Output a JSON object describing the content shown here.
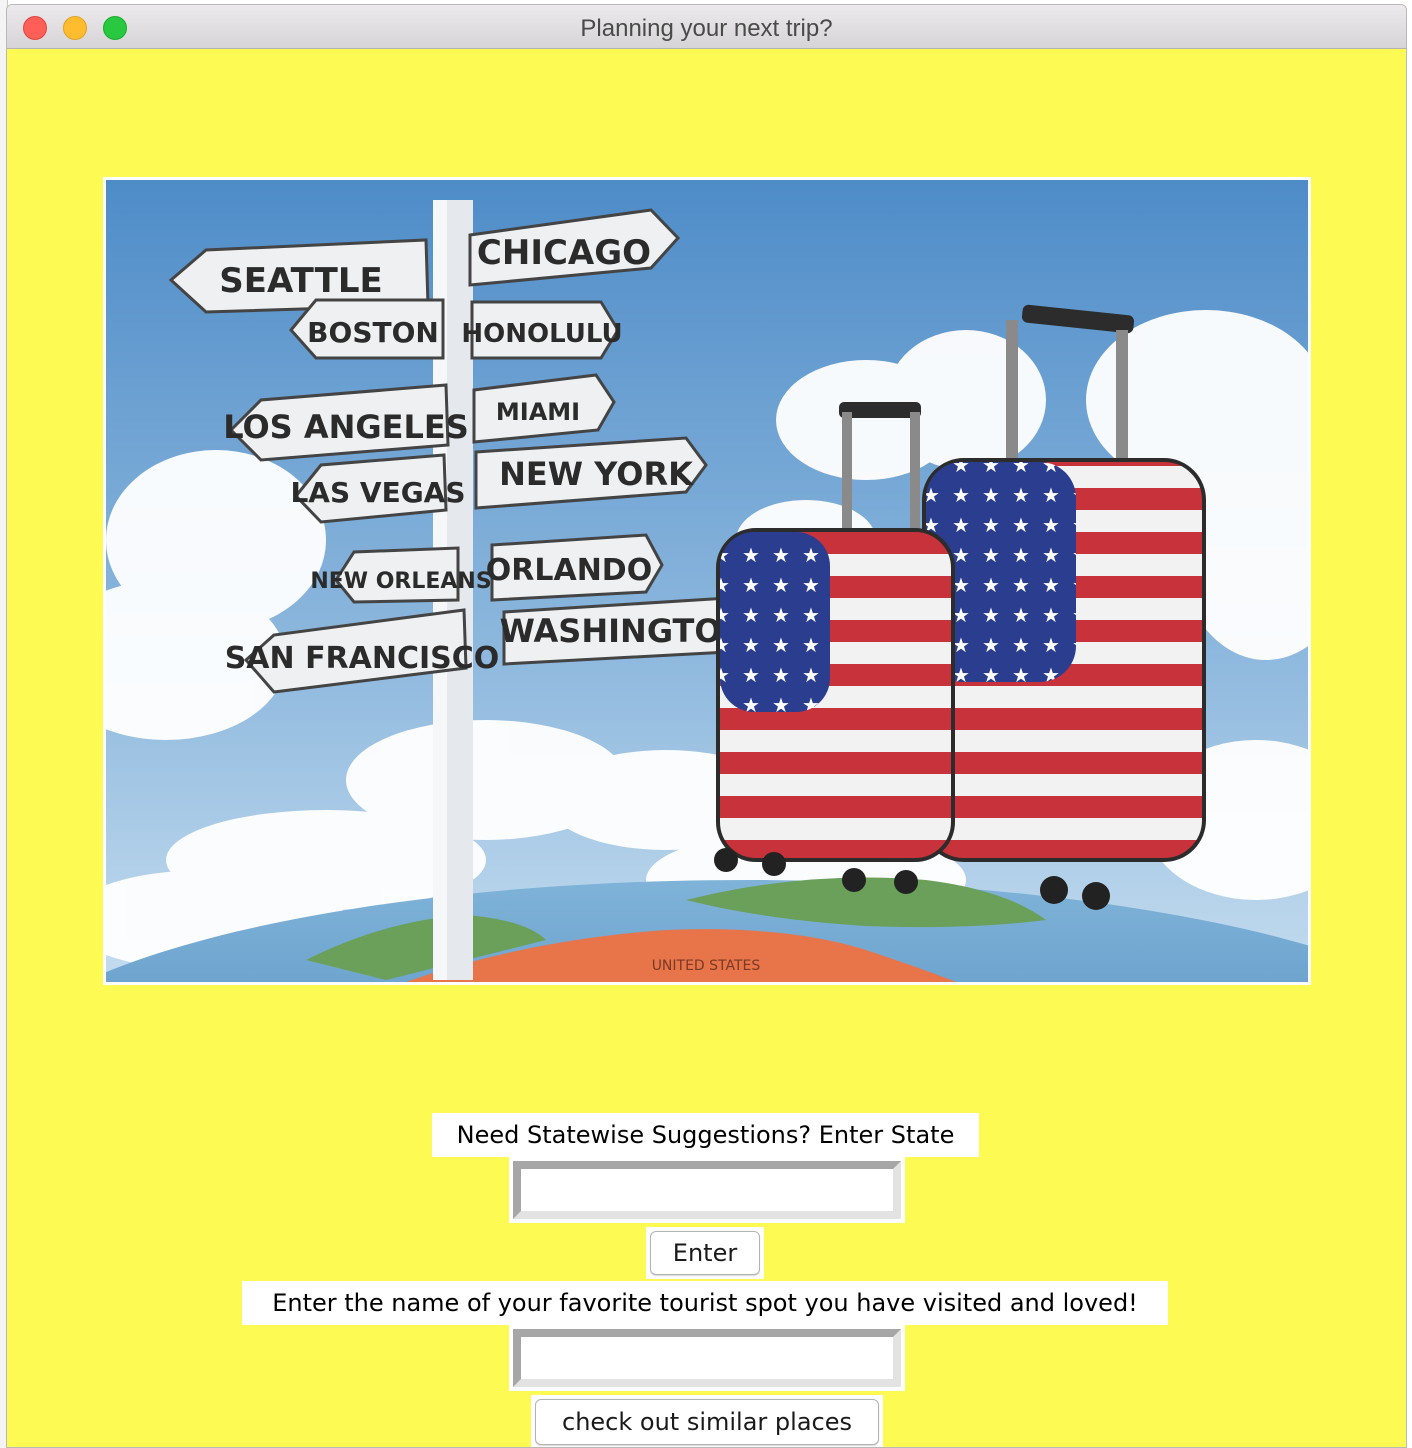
{
  "window": {
    "title": "Planning your next trip?",
    "background_color": "#fefa54"
  },
  "hero": {
    "signs": [
      "SEATTLE",
      "CHICAGO",
      "BOSTON",
      "HONOLULU",
      "LOS ANGELES",
      "MIAMI",
      "LAS VEGAS",
      "NEW YORK",
      "NEW ORLEANS",
      "ORLANDO",
      "SAN FRANCISCO",
      "WASHINGTON"
    ],
    "globe_text": "UNITED STATES"
  },
  "state_section": {
    "label": "Need Statewise Suggestions? Enter State",
    "input_value": "",
    "button_label": "Enter"
  },
  "favorite_section": {
    "label": "Enter the name of your favorite tourist spot you have visited and loved!",
    "input_value": "",
    "button_label": "check out similar places"
  }
}
